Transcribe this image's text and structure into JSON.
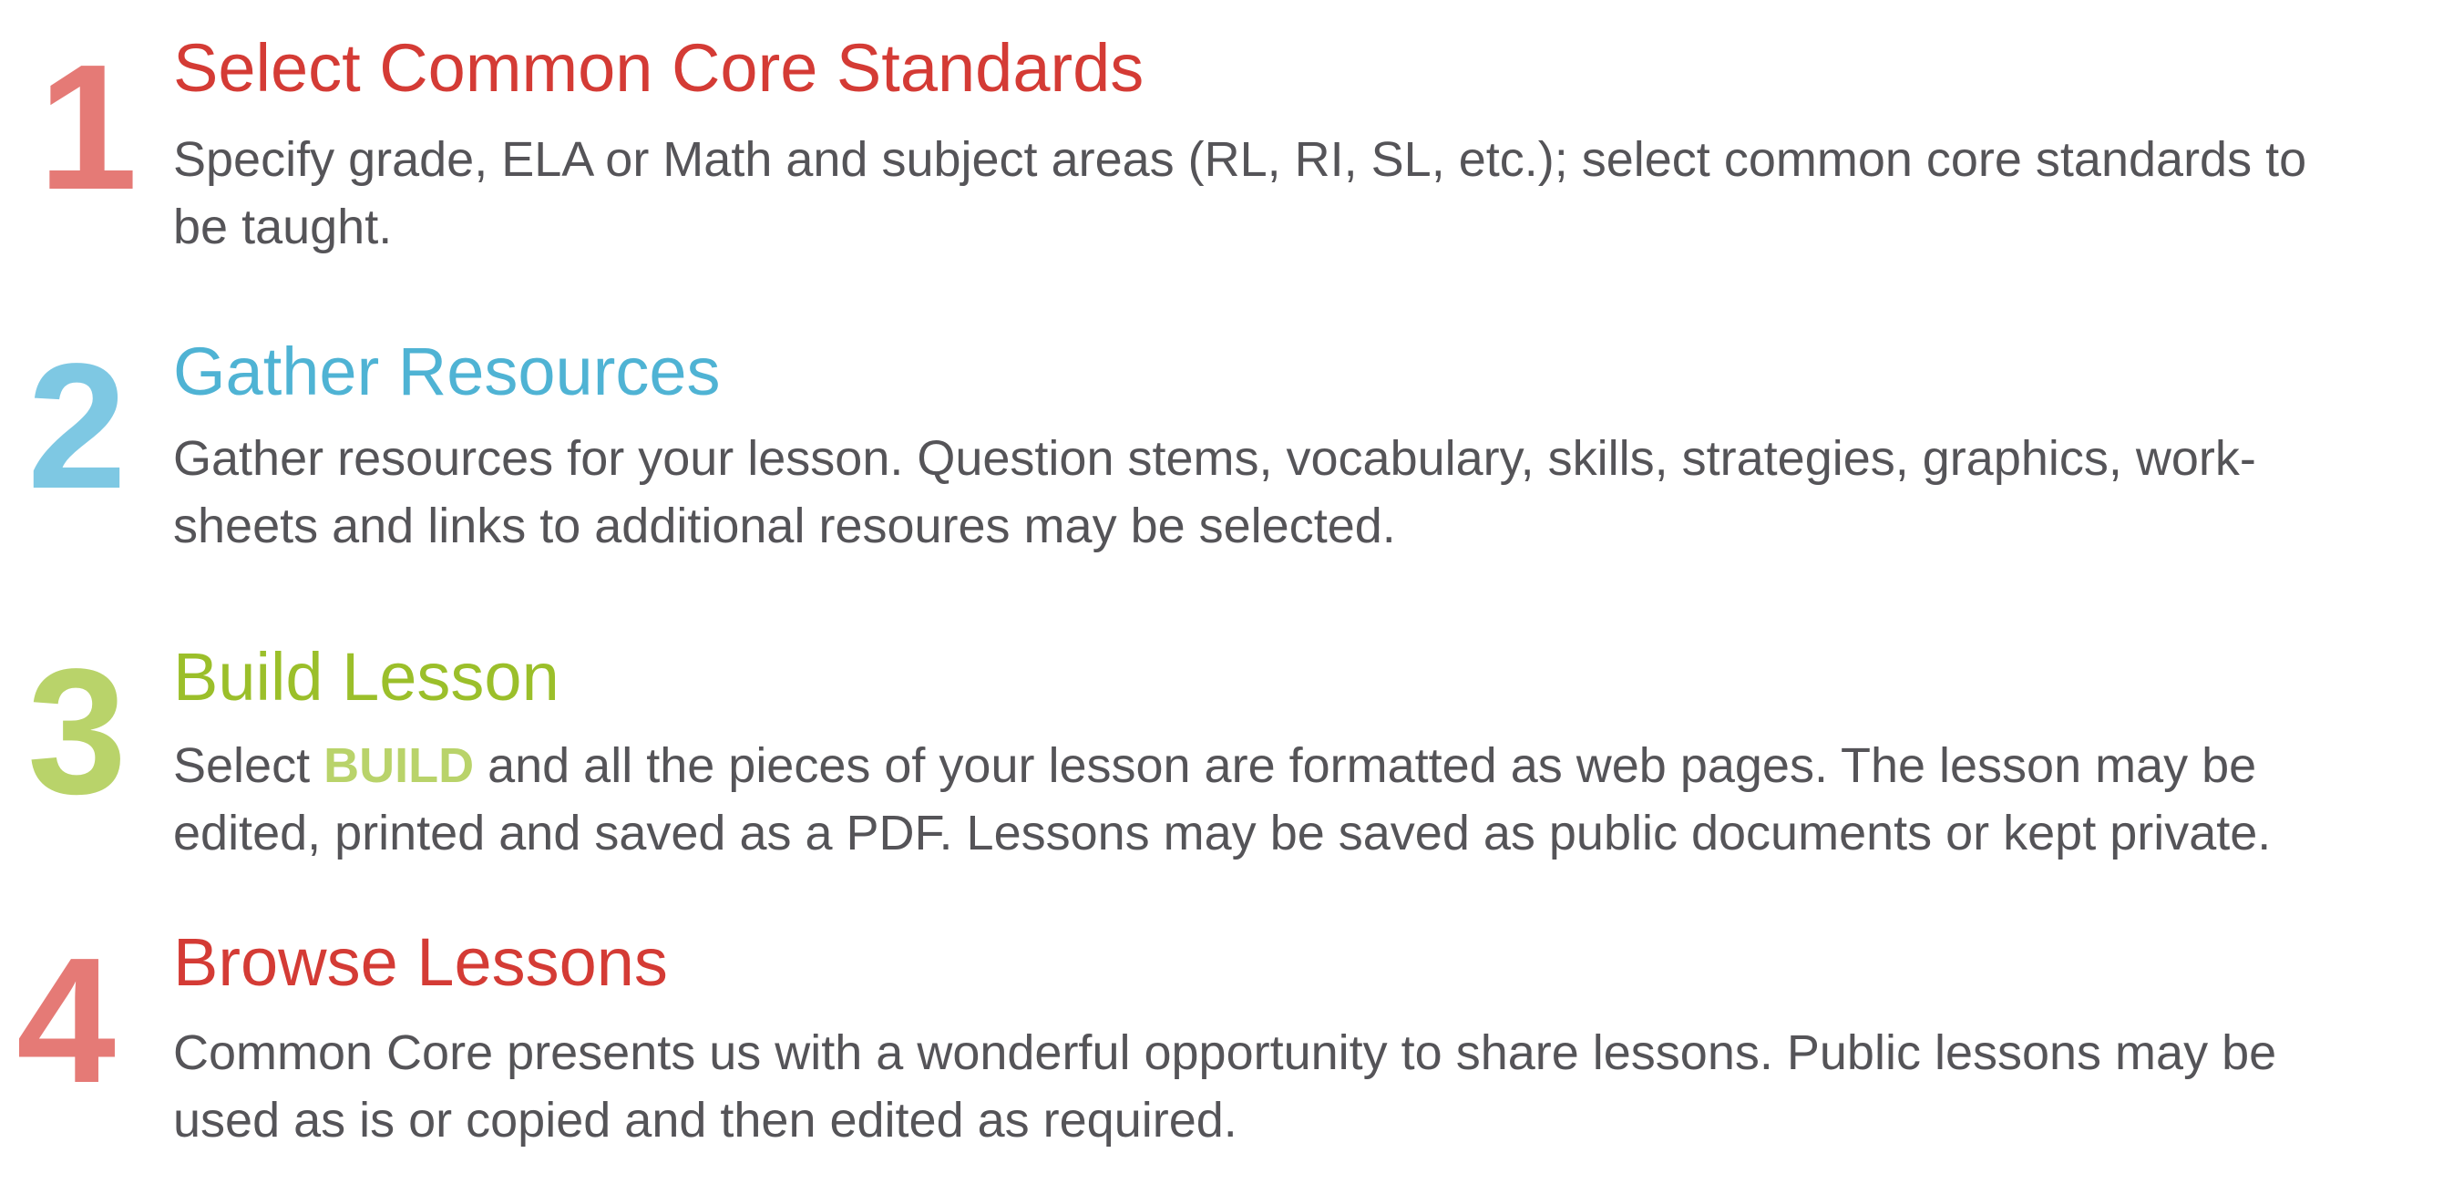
{
  "colors": {
    "step1_number": "#e57a76",
    "step1_title": "#d43b35",
    "step2_number": "#7ec8e3",
    "step2_title": "#4fb3d4",
    "step3_number": "#b9d36a",
    "step3_title": "#9bbf2a",
    "step4_number": "#e57a76",
    "step4_title": "#d43b35",
    "body_text": "#555458",
    "highlight": "#b9d36a"
  },
  "steps": [
    {
      "number": "1",
      "title": "Select Common Core Standards",
      "lines": [
        "Specify grade, ELA or Math and subject areas (RL, RI, SL, etc.); select common core standards to",
        "be taught."
      ]
    },
    {
      "number": "2",
      "title": "Gather Resources",
      "lines": [
        "Gather resources for your lesson.  Question stems, vocabulary, skills, strategies, graphics, work-",
        "sheets and links to additional resoures may be selected."
      ]
    },
    {
      "number": "3",
      "title": "Build Lesson",
      "line1_before": "Select ",
      "keyword": "BUILD",
      "line1_after": " and all the pieces of your lesson are formatted as web pages.  The lesson may be",
      "line2": "edited, printed and saved as a PDF.  Lessons may be saved as public documents or kept private."
    },
    {
      "number": "4",
      "title": "Browse Lessons",
      "lines": [
        "Common Core presents us with a wonderful opportunity to share lessons. Public lessons may be",
        "used as is or copied and then edited as required."
      ]
    }
  ]
}
